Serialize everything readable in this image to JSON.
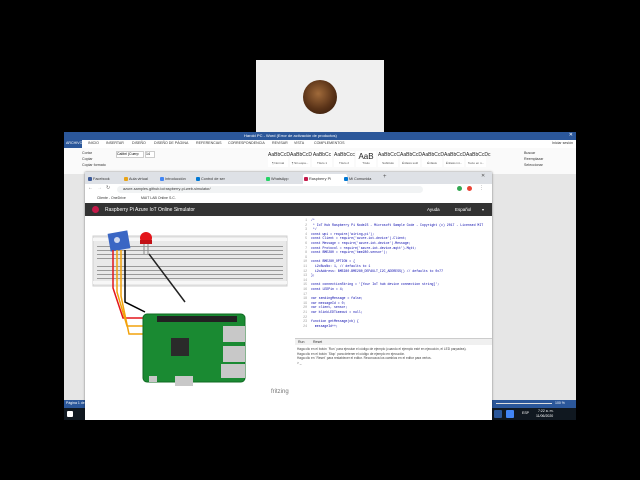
{
  "word": {
    "title": "Harold PC - Word (Error de activación de productos)",
    "menu": [
      "ARCHIVO",
      "INICIO",
      "INSERTAR",
      "DISEÑO",
      "DISEÑO DE PÁGINA",
      "REFERENCIAS",
      "CORRESPONDENCIA",
      "REVISAR",
      "VISTA",
      "COMPLEMENTOS"
    ],
    "font_name": "Calibri (Cuerp",
    "font_size": "14",
    "clipboard": [
      "Cortar",
      "Copiar",
      "Copiar formato"
    ],
    "styles": [
      {
        "sample": "AaBbCcDc",
        "name": "¶ Normal"
      },
      {
        "sample": "AaBbCcDc",
        "name": "¶ Sin espa..."
      },
      {
        "sample": "AaBbCc",
        "name": "Título 1"
      },
      {
        "sample": "AaBbCcc",
        "name": "Título 2"
      },
      {
        "sample": "AaB",
        "name": "Título"
      },
      {
        "sample": "AaBbCcC",
        "name": "Subtítulo"
      },
      {
        "sample": "AaBbCcDc",
        "name": "Énfasis sutil"
      },
      {
        "sample": "AaBbCcDc",
        "name": "Énfasis"
      },
      {
        "sample": "AaBbCcDc",
        "name": "Énfasis int..."
      },
      {
        "sample": "AaBbCcDc",
        "name": "Texto en n..."
      }
    ],
    "find": [
      "Buscar",
      "Reemplazar",
      "Seleccionar"
    ],
    "user": "Iniciar sesión",
    "status_left": "Página 1 de 1",
    "zoom": "100 %"
  },
  "taskbar": {
    "time": "7:22 a. m.",
    "date": "11/06/2020",
    "lang": "ESP"
  },
  "chrome": {
    "tabs": [
      {
        "label": "Facebook",
        "color": "#3b5998"
      },
      {
        "label": "Aula virtual",
        "color": "#e8a317"
      },
      {
        "label": "Introducción",
        "color": "#4285f4"
      },
      {
        "label": "Control de ser",
        "color": "#0078d4"
      },
      {
        "label": "WhatsApp",
        "color": "#25d366"
      },
      {
        "label": "Raspberry Pi",
        "color": "#c51a4a"
      },
      {
        "label": "Mi Comunida",
        "color": "#0078d4"
      }
    ],
    "url": "azure-samples.github.io/raspberry-pi-web-simulator/",
    "bookmarks": [
      "Cliente - OneDrive",
      "MAIT LAB Online S.C."
    ]
  },
  "simulator": {
    "title": "Raspberry Pi Azure IoT Online Simulator",
    "help": "Ayuda",
    "language": "Español",
    "watermark": "fritzing",
    "code": [
      "/*",
      " * IoT Hub Raspberry Pi NodeJS - Microsoft Sample Code - Copyright (c) 2017 - Licensed MIT",
      " */",
      "const wpi = require('wiring-pi');",
      "const Client = require('azure-iot-device').Client;",
      "const Message = require('azure-iot-device').Message;",
      "const Protocol = require('azure-iot-device-mqtt').Mqtt;",
      "const BME280 = require('bme280-sensor');",
      "",
      "const BME280_OPTION = {",
      "  i2cBusNo: 1, // defaults to 1",
      "  i2cAddress: BME280.BME280_DEFAULT_I2C_ADDRESS() // defaults to 0x77",
      "};",
      "",
      "const connectionString = '[Your IoT hub device connection string]';",
      "const LEDPin = 4;",
      "",
      "var sendingMessage = false;",
      "var messageId = 0;",
      "var client, sensor;",
      "var blinkLEDTimeout = null;",
      "",
      "function getMessage(cb) {",
      "  messageId++;"
    ],
    "run_label": "Run",
    "reset_label": "Reset",
    "console": [
      "Haga clic en el botón `Run` para ejecutar el código de ejemplo (cuando el ejemplo esté en ejecución, el LED parpadea).",
      "Haga clic en el botón `Stop` para detener el código de ejemplo en ejecución.",
      "Haga clic en `Reset` para restablecer el editor. Reconozca los cambios en el editor para verlos.",
      "> _"
    ]
  }
}
